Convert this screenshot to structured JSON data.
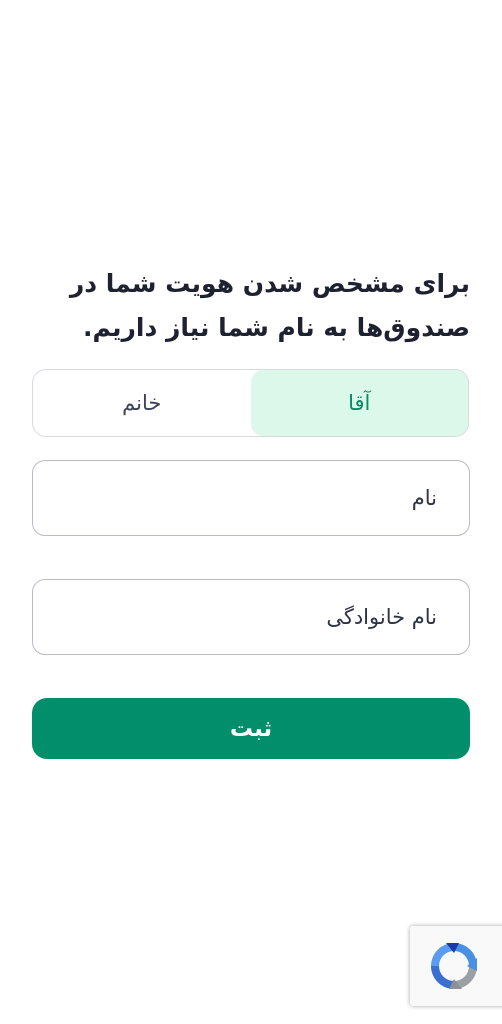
{
  "heading": "برای مشخص شدن هویت شما در صندوق‌ها به نام شما نیاز داریم.",
  "gender": {
    "options": [
      {
        "label": "آقا",
        "selected": true
      },
      {
        "label": "خانم",
        "selected": false
      }
    ],
    "selected_color": "#dcf8ea",
    "selected_text_color": "#0b8a64"
  },
  "form": {
    "first_name_placeholder": "نام",
    "last_name_placeholder": "نام خانوادگی",
    "submit_label": "ثبت"
  },
  "colors": {
    "primary": "#028d6b",
    "text": "#1e2230"
  },
  "recaptcha": {
    "icon": "recaptcha-icon"
  }
}
